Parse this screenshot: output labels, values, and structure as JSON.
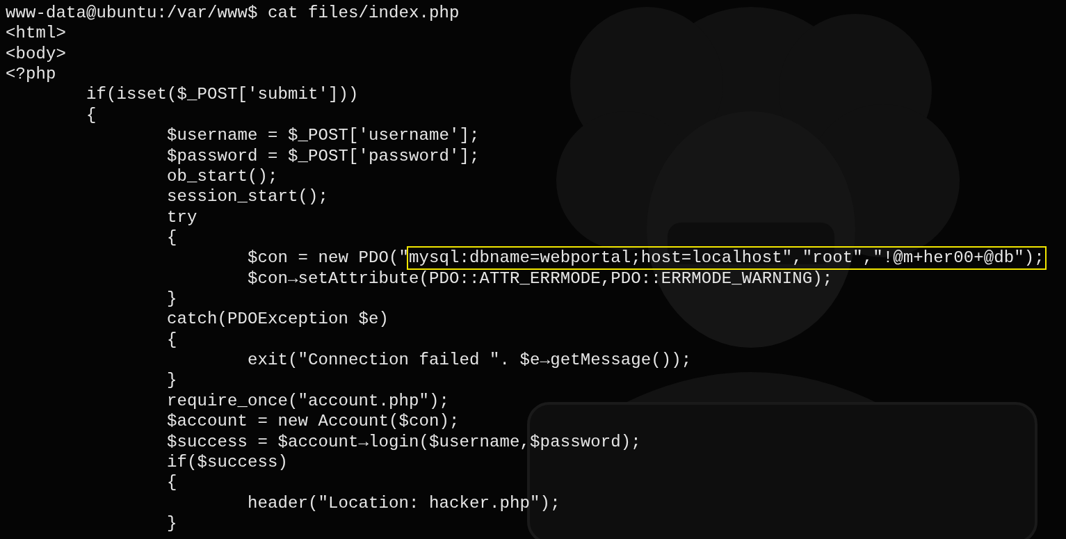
{
  "terminal": {
    "lines": [
      {
        "text": "www-data@ubuntu:/var/www$ cat files/index.php"
      },
      {
        "text": "<html>"
      },
      {
        "text": "<body>"
      },
      {
        "text": "<?php"
      },
      {
        "text": "        if(isset($_POST['submit']))"
      },
      {
        "text": "        {"
      },
      {
        "text": "                $username = $_POST['username'];"
      },
      {
        "text": "                $password = $_POST['password'];"
      },
      {
        "text": "                ob_start();"
      },
      {
        "text": "                session_start();"
      },
      {
        "text": "                try"
      },
      {
        "text": "                {"
      },
      {
        "text": "                        $con = new PDO(\"",
        "highlight": "mysql:dbname=webportal;host=localhost\",\"root\",\"!@m+her00+@db\");"
      },
      {
        "text": "                        $con→setAttribute(PDO::ATTR_ERRMODE,PDO::ERRMODE_WARNING);"
      },
      {
        "text": "                }"
      },
      {
        "text": "                catch(PDOException $e)"
      },
      {
        "text": "                {"
      },
      {
        "text": "                        exit(\"Connection failed \". $e→getMessage());"
      },
      {
        "text": "                }"
      },
      {
        "text": "                require_once(\"account.php\");"
      },
      {
        "text": "                $account = new Account($con);"
      },
      {
        "text": "                $success = $account→login($username,$password);"
      },
      {
        "text": "                if($success)"
      },
      {
        "text": "                {"
      },
      {
        "text": "                        header(\"Location: hacker.php\");"
      },
      {
        "text": "                }"
      }
    ]
  }
}
